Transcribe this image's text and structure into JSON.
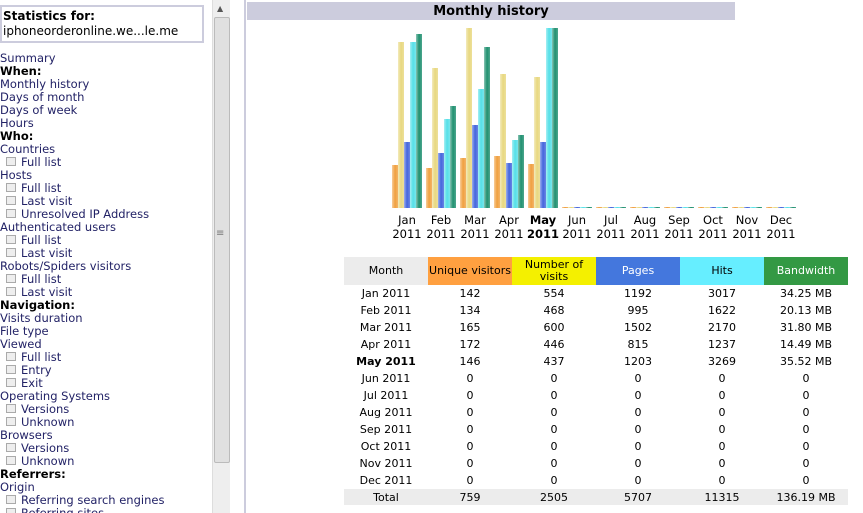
{
  "sidebar": {
    "stat_label": "Statistics for:",
    "site": "iphoneorderonline.we...le.me",
    "items": [
      {
        "t": "link",
        "label": "Summary"
      },
      {
        "t": "head",
        "label": "When:"
      },
      {
        "t": "link",
        "label": "Monthly history"
      },
      {
        "t": "link",
        "label": "Days of month"
      },
      {
        "t": "link",
        "label": "Days of week"
      },
      {
        "t": "link",
        "label": "Hours"
      },
      {
        "t": "head",
        "label": "Who:"
      },
      {
        "t": "link",
        "label": "Countries"
      },
      {
        "t": "sub",
        "label": "Full list"
      },
      {
        "t": "link",
        "label": "Hosts"
      },
      {
        "t": "sub",
        "label": "Full list"
      },
      {
        "t": "sub",
        "label": "Last visit"
      },
      {
        "t": "sub",
        "label": "Unresolved IP Address"
      },
      {
        "t": "link",
        "label": "Authenticated users"
      },
      {
        "t": "sub",
        "label": "Full list"
      },
      {
        "t": "sub",
        "label": "Last visit"
      },
      {
        "t": "link",
        "label": "Robots/Spiders visitors"
      },
      {
        "t": "sub",
        "label": "Full list"
      },
      {
        "t": "sub",
        "label": "Last visit"
      },
      {
        "t": "head",
        "label": "Navigation:"
      },
      {
        "t": "link",
        "label": "Visits duration"
      },
      {
        "t": "link",
        "label": "File type"
      },
      {
        "t": "link",
        "label": "Viewed"
      },
      {
        "t": "sub",
        "label": "Full list"
      },
      {
        "t": "sub",
        "label": "Entry"
      },
      {
        "t": "sub",
        "label": "Exit"
      },
      {
        "t": "link",
        "label": "Operating Systems"
      },
      {
        "t": "sub",
        "label": "Versions"
      },
      {
        "t": "sub",
        "label": "Unknown"
      },
      {
        "t": "link",
        "label": "Browsers"
      },
      {
        "t": "sub",
        "label": "Versions"
      },
      {
        "t": "sub",
        "label": "Unknown"
      },
      {
        "t": "head",
        "label": "Referrers:"
      },
      {
        "t": "link",
        "label": "Origin"
      },
      {
        "t": "sub",
        "label": "Referring search engines"
      },
      {
        "t": "sub",
        "label": "Referring sites"
      }
    ]
  },
  "main": {
    "title": "Monthly history"
  },
  "colors": {
    "unique": "#f0a040",
    "visits": "#e8d880",
    "pages": "#4466dd",
    "hits": "#55e0e8",
    "bandwidth": "#209070"
  },
  "table": {
    "headers": [
      {
        "label": "Month",
        "bg": "#ececec"
      },
      {
        "label": "Unique visitors",
        "bg": "#ffa040"
      },
      {
        "label": "Number of visits",
        "bg": "#f4f000"
      },
      {
        "label": "Pages",
        "bg": "#4477dd"
      },
      {
        "label": "Hits",
        "bg": "#66eeff"
      },
      {
        "label": "Bandwidth",
        "bg": "#339944"
      }
    ],
    "rows": [
      {
        "m": "Jan",
        "y": "2011",
        "month": "Jan 2011",
        "u": 142,
        "v": 554,
        "p": 1192,
        "h": 3017,
        "bw": 34.25,
        "bwt": "34.25 MB"
      },
      {
        "m": "Feb",
        "y": "2011",
        "month": "Feb 2011",
        "u": 134,
        "v": 468,
        "p": 995,
        "h": 1622,
        "bw": 20.13,
        "bwt": "20.13 MB"
      },
      {
        "m": "Mar",
        "y": "2011",
        "month": "Mar 2011",
        "u": 165,
        "v": 600,
        "p": 1502,
        "h": 2170,
        "bw": 31.8,
        "bwt": "31.80 MB"
      },
      {
        "m": "Apr",
        "y": "2011",
        "month": "Apr 2011",
        "u": 172,
        "v": 446,
        "p": 815,
        "h": 1237,
        "bw": 14.49,
        "bwt": "14.49 MB"
      },
      {
        "m": "May",
        "y": "2011",
        "month": "May 2011",
        "u": 146,
        "v": 437,
        "p": 1203,
        "h": 3269,
        "bw": 35.52,
        "bwt": "35.52 MB",
        "current": true
      },
      {
        "m": "Jun",
        "y": "2011",
        "month": "Jun 2011",
        "u": 0,
        "v": 0,
        "p": 0,
        "h": 0,
        "bw": 0,
        "bwt": "0"
      },
      {
        "m": "Jul",
        "y": "2011",
        "month": "Jul 2011",
        "u": 0,
        "v": 0,
        "p": 0,
        "h": 0,
        "bw": 0,
        "bwt": "0"
      },
      {
        "m": "Aug",
        "y": "2011",
        "month": "Aug 2011",
        "u": 0,
        "v": 0,
        "p": 0,
        "h": 0,
        "bw": 0,
        "bwt": "0"
      },
      {
        "m": "Sep",
        "y": "2011",
        "month": "Sep 2011",
        "u": 0,
        "v": 0,
        "p": 0,
        "h": 0,
        "bw": 0,
        "bwt": "0"
      },
      {
        "m": "Oct",
        "y": "2011",
        "month": "Oct 2011",
        "u": 0,
        "v": 0,
        "p": 0,
        "h": 0,
        "bw": 0,
        "bwt": "0"
      },
      {
        "m": "Nov",
        "y": "2011",
        "month": "Nov 2011",
        "u": 0,
        "v": 0,
        "p": 0,
        "h": 0,
        "bw": 0,
        "bwt": "0"
      },
      {
        "m": "Dec",
        "y": "2011",
        "month": "Dec 2011",
        "u": 0,
        "v": 0,
        "p": 0,
        "h": 0,
        "bw": 0,
        "bwt": "0"
      }
    ],
    "total": {
      "label": "Total",
      "u": "759",
      "v": "2505",
      "p": "5707",
      "h": "11315",
      "bw": "136.19 MB"
    }
  }
}
